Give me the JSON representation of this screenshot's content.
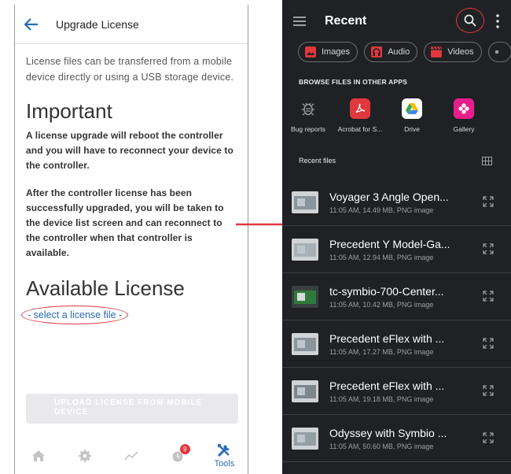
{
  "left": {
    "title": "Upgrade License",
    "intro": "License files can be transferred from a mobile device directly or using a USB storage device.",
    "important_heading": "Important",
    "para1": "A license upgrade will reboot the controller and you will have to reconnect your device to the controller.",
    "para2": "After the controller license has been successfully upgraded, you will be taken to the device list screen and can reconnect to the controller when that controller is available.",
    "available_heading": "Available License",
    "select_link": "- select a license file -",
    "upload_button": "UPLOAD LICENSE FROM MOBILE DEVICE",
    "nav": {
      "alarm_badge": "9",
      "tools_label": "Tools"
    }
  },
  "right": {
    "title": "Recent",
    "chips": [
      {
        "label": "Images",
        "icon": "image-icon",
        "color": "#e0383e"
      },
      {
        "label": "Audio",
        "icon": "audio-icon",
        "color": "#e0383e"
      },
      {
        "label": "Videos",
        "icon": "video-icon",
        "color": "#e0383e"
      }
    ],
    "browse_heading": "BROWSE FILES IN OTHER APPS",
    "apps": [
      {
        "label": "Bug reports",
        "icon": "bug-icon"
      },
      {
        "label": "Acrobat for S...",
        "icon": "acrobat-icon"
      },
      {
        "label": "Drive",
        "icon": "drive-icon"
      },
      {
        "label": "Gallery",
        "icon": "gallery-icon"
      }
    ],
    "recent_files_label": "Recent files",
    "files": [
      {
        "name": "Voyager 3 Angle Open...",
        "meta": "11:05 AM, 14.49 MB, PNG image"
      },
      {
        "name": "Precedent Y Model-Ga...",
        "meta": "11:05 AM, 12.94 MB, PNG image"
      },
      {
        "name": "tc-symbio-700-Center...",
        "meta": "11:05 AM, 10.42 MB, PNG image"
      },
      {
        "name": "Precedent eFlex with ...",
        "meta": "11:05 AM, 17.27 MB, PNG image"
      },
      {
        "name": "Precedent eFlex with ...",
        "meta": "11:05 AM, 19.18 MB, PNG image"
      },
      {
        "name": "Odyssey with Symbio ...",
        "meta": "11:05 AM, 50.60 MB, PNG image"
      }
    ]
  },
  "colors": {
    "accent_blue": "#2a6cb8",
    "annotation_red": "#e0383e",
    "dark_bg": "#202124"
  }
}
